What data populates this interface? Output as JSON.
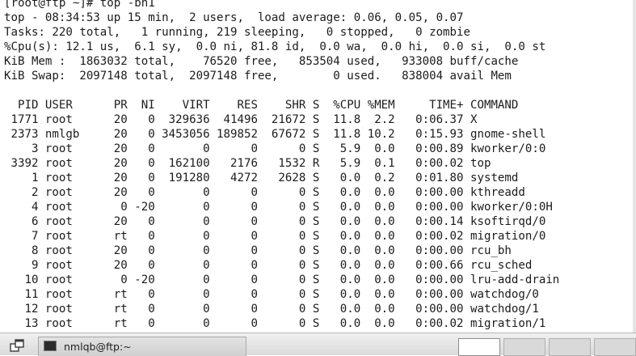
{
  "terminal": {
    "lines": [
      "[root@ftp ~]# top -bn1",
      "top - 08:34:53 up 15 min,  2 users,  load average: 0.06, 0.05, 0.07",
      "Tasks: 220 total,   1 running, 219 sleeping,   0 stopped,   0 zombie",
      "%Cpu(s): 12.1 us,  6.1 sy,  0.0 ni, 81.8 id,  0.0 wa,  0.0 hi,  0.0 si,  0.0 st",
      "KiB Mem :  1863032 total,    76520 free,   853504 used,   933008 buff/cache",
      "KiB Swap:  2097148 total,  2097148 free,        0 used.   838004 avail Mem",
      "",
      "  PID USER      PR  NI    VIRT    RES    SHR S  %CPU %MEM     TIME+ COMMAND",
      " 1771 root      20   0  329636  41496  21672 S  11.8  2.2   0:06.37 X",
      " 2373 nmlgb     20   0 3453056 189852  67672 S  11.8 10.2   0:15.93 gnome-shell",
      "    3 root      20   0       0      0      0 S   5.9  0.0   0:00.89 kworker/0:0",
      " 3392 root      20   0  162100   2176   1532 R   5.9  0.1   0:00.02 top",
      "    1 root      20   0  191280   4272   2628 S   0.0  0.2   0:01.80 systemd",
      "    2 root      20   0       0      0      0 S   0.0  0.0   0:00.00 kthreadd",
      "    4 root       0 -20       0      0      0 S   0.0  0.0   0:00.00 kworker/0:0H",
      "    6 root      20   0       0      0      0 S   0.0  0.0   0:00.14 ksoftirqd/0",
      "    7 root      rt   0       0      0      0 S   0.0  0.0   0:00.02 migration/0",
      "    8 root      20   0       0      0      0 S   0.0  0.0   0:00.00 rcu_bh",
      "    9 root      20   0       0      0      0 S   0.0  0.0   0:00.66 rcu_sched",
      "   10 root       0 -20       0      0      0 S   0.0  0.0   0:00.00 lru-add-drain",
      "   11 root      rt   0       0      0      0 S   0.0  0.0   0:00.00 watchdog/0",
      "   12 root      rt   0       0      0      0 S   0.0  0.0   0:00.00 watchdog/1",
      "   13 root      rt   0       0      0      0 S   0.0  0.0   0:00.02 migration/1"
    ]
  },
  "taskbar": {
    "show_desktop_icon": "show-desktop-icon",
    "window_icon": "terminal-icon",
    "window_label": "nmlqb@ftp:~",
    "workspaces": [
      "workspace-1",
      "workspace-2",
      "workspace-3",
      "workspace-4"
    ],
    "active_workspace": "workspace-1"
  }
}
